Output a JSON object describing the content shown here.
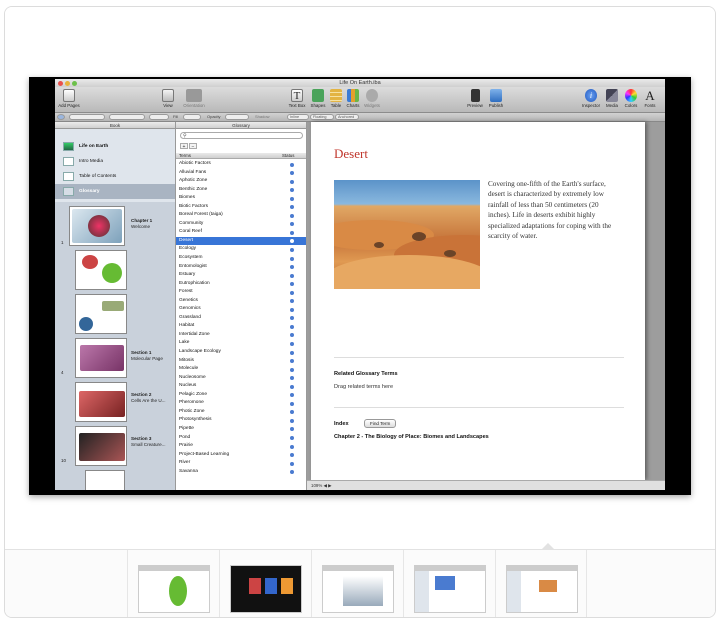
{
  "window": {
    "title": "Life On Earth.iba"
  },
  "toolbar": {
    "add_pages": "Add Pages",
    "view": "View",
    "orientation": "Orientation",
    "text_box": "Text Box",
    "shapes": "Shapes",
    "table": "Table",
    "charts": "Charts",
    "widgets": "Widgets",
    "preview": "Preview",
    "publish": "Publish",
    "inspector": "Inspector",
    "media": "Media",
    "colors": "Colors",
    "fonts": "Fonts"
  },
  "format_bar": {
    "fill": "Fill",
    "opacity": "Opacity",
    "shadow": "Shadow",
    "inline": "Inline",
    "floating": "Floating",
    "anchored": "Anchored"
  },
  "book_pane": {
    "header": "Book",
    "items": [
      {
        "label": "Life on Earth",
        "selected": false
      },
      {
        "label": "Intro Media",
        "selected": false
      },
      {
        "label": "Table of Contents",
        "selected": false
      },
      {
        "label": "Glossary",
        "selected": true
      }
    ],
    "thumbnails": [
      {
        "num": "1",
        "title": "Chapter 1",
        "sub": "Welcome"
      },
      {
        "num": "",
        "title": "",
        "sub": ""
      },
      {
        "num": "",
        "title": "",
        "sub": ""
      },
      {
        "num": "4",
        "title": "Section 1",
        "sub": "Molecular Page"
      },
      {
        "num": "",
        "title": "Section 2",
        "sub": "Cells Are the U..."
      },
      {
        "num": "10",
        "title": "Section 3",
        "sub": "Small Creature..."
      }
    ]
  },
  "glossary_pane": {
    "header": "Glossary",
    "col_terms": "Terms",
    "col_status": "Status",
    "add": "+",
    "remove": "−",
    "selected": "Desert",
    "terms": [
      "Abiotic Factors",
      "Alluvial Fans",
      "Aphotic Zone",
      "Benthic Zone",
      "Biomes",
      "Biotic Factors",
      "Boreal Forest (taiga)",
      "Community",
      "Coral Reef",
      "Desert",
      "Ecology",
      "Ecosystem",
      "Entomologist",
      "Estuary",
      "Eutrophication",
      "Forest",
      "Genetics",
      "Genomics",
      "Grassland",
      "Habitat",
      "Intertidal Zone",
      "Lake",
      "Landscape Ecology",
      "Mitosis",
      "Molecule",
      "Nucleosome",
      "Nucleus",
      "Pelagic Zone",
      "Pheromone",
      "Photic Zone",
      "Photosynthesis",
      "Pipette",
      "Pond",
      "Prairie",
      "Project-Based Learning",
      "River",
      "Savanna"
    ]
  },
  "page": {
    "title": "Desert",
    "body": "Covering one-fifth of the Earth's surface, desert is characterized by extremely low rainfall of less than 50 centimeters (20 inches). Life in deserts exhibit highly specialized adaptations for coping with the scarcity of water.",
    "related_title": "Related Glossary Terms",
    "related_hint": "Drag related terms here",
    "index_label": "Index",
    "find_term": "Find Term",
    "chapter_ref": "Chapter 2 - The Biology of Place: Biomes and Landscapes"
  },
  "status_bar": {
    "zoom": "109%"
  },
  "gallery": {
    "count": 5,
    "selected": 5
  }
}
